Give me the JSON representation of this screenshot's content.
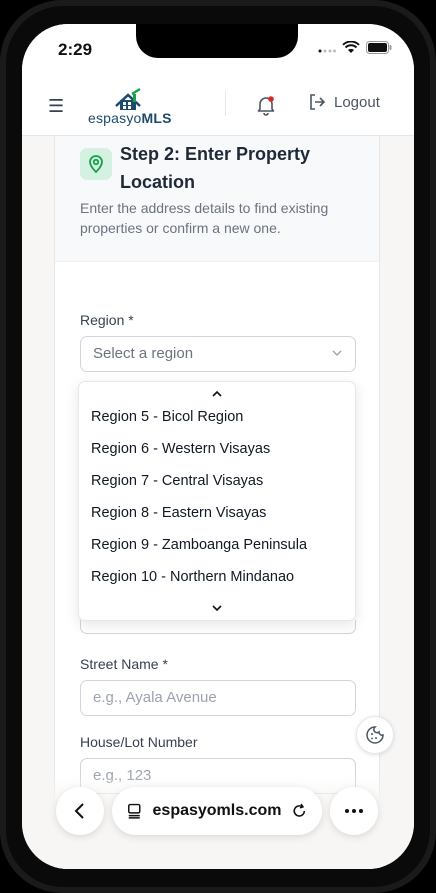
{
  "status_bar": {
    "time": "2:29"
  },
  "header": {
    "logo_prefix": "espasyo",
    "logo_suffix": "MLS",
    "logout_label": "Logout"
  },
  "step": {
    "title": "Step 2: Enter Property Location",
    "description": "Enter the address details to find existing properties or confirm a new one."
  },
  "region": {
    "label": "Region *",
    "placeholder": "Select a region",
    "options": [
      "Region 5 - Bicol Region",
      "Region 6 - Western Visayas",
      "Region 7 - Central Visayas",
      "Region 8 - Eastern Visayas",
      "Region 9 - Zamboanga Peninsula",
      "Region 10 - Northern Mindanao"
    ]
  },
  "street": {
    "label": "Street Name *",
    "placeholder": "e.g., Ayala Avenue"
  },
  "house": {
    "label": "House/Lot Number",
    "placeholder": "e.g., 123"
  },
  "browser": {
    "url": "espasyomls.com"
  },
  "colors": {
    "accent_green": "#16a34a",
    "badge_bg": "#d4f1e2",
    "notification_dot": "#dc2626",
    "logo_blue": "#1e4a6e"
  }
}
